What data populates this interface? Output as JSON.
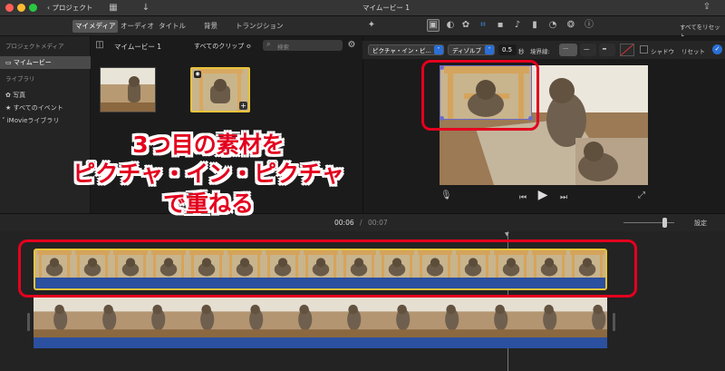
{
  "window": {
    "back_label": "プロジェクト",
    "title": "マイムービー 1"
  },
  "left_tabs": [
    "マイメディア",
    "オーディオ",
    "タイトル",
    "背景",
    "トランジション"
  ],
  "sidebar": {
    "section_project": "プロジェクトメディア",
    "project_item": "マイムービー",
    "section_library": "ライブラリ",
    "items": [
      "写真",
      "すべてのイベント",
      "iMovieライブラリ"
    ]
  },
  "browser": {
    "project_title": "マイムービー 1",
    "filter_label": "すべてのクリップ ≎",
    "search_placeholder": "検索"
  },
  "viewer_toolbar": {
    "reset_all": "すべてをリセット"
  },
  "adjust": {
    "mode": "ピクチャ・イン・ピ…",
    "transition": "ディゾルブ",
    "duration": "0.5",
    "unit": "秒",
    "border_label": "境界線:",
    "shadow_label": "シャドウ",
    "reset_label": "リセット"
  },
  "playback": {
    "current_time": "00:06",
    "separator": "/",
    "total_time": "00:07",
    "settings_label": "設定"
  },
  "annotation": {
    "line1": "3つ目の素材を",
    "line2": "ピクチャ・イン・ピクチャ",
    "line3": "で重ねる"
  },
  "colors": {
    "accent": "#2a6fd6",
    "annotation": "#e4001e",
    "clip_border": "#e8c33a",
    "audio": "#2b50a0"
  }
}
